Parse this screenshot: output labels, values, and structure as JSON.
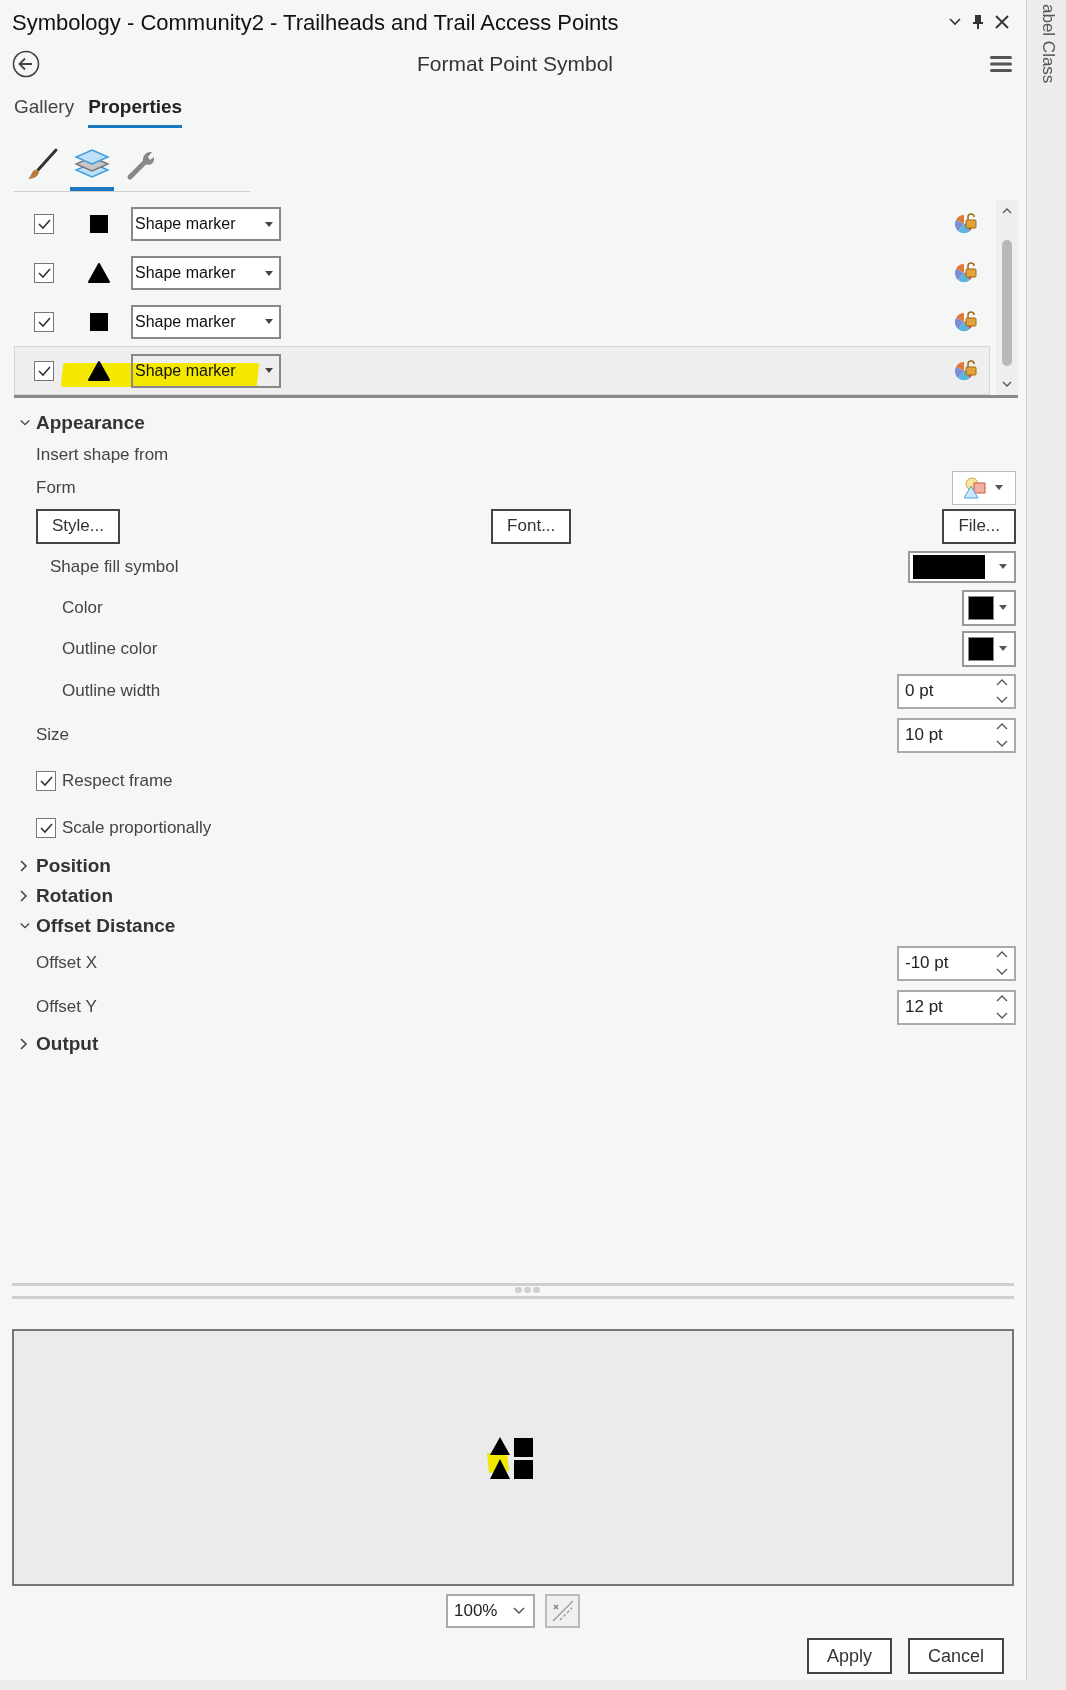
{
  "window": {
    "title": "Symbology - Community2 - Trailheads and Trail Access Points"
  },
  "side_tab": {
    "label": "abel Class"
  },
  "header": {
    "title": "Format Point Symbol"
  },
  "tabs": [
    {
      "label": "Gallery",
      "selected": false
    },
    {
      "label": "Properties",
      "selected": true
    }
  ],
  "icon_tabs": [
    {
      "kind": "brush",
      "selected": false
    },
    {
      "kind": "layers",
      "selected": true
    },
    {
      "kind": "wrench",
      "selected": false
    }
  ],
  "layers": [
    {
      "checked": true,
      "kind": "square",
      "type": "Shape marker",
      "selected": false,
      "highlighted": false
    },
    {
      "checked": true,
      "kind": "triangle",
      "type": "Shape marker",
      "selected": false,
      "highlighted": false
    },
    {
      "checked": true,
      "kind": "square",
      "type": "Shape marker",
      "selected": false,
      "highlighted": false
    },
    {
      "checked": true,
      "kind": "triangle",
      "type": "Shape marker",
      "selected": true,
      "highlighted": true
    }
  ],
  "properties": [
    {
      "kind": "group",
      "label": "Appearance",
      "expanded": true,
      "children": [
        {
          "kind": "label",
          "label": "Insert shape from"
        },
        {
          "kind": "picker",
          "label": "Form"
        },
        {
          "kind": "buttons",
          "buttons": [
            "Style...",
            "Font...",
            "File..."
          ]
        },
        {
          "kind": "swatch",
          "label": "Shape fill symbol",
          "children": [
            {
              "kind": "color",
              "label": "Color"
            },
            {
              "kind": "color",
              "label": "Outline color"
            },
            {
              "kind": "spin",
              "label": "Outline width",
              "value": "0 pt"
            }
          ]
        },
        {
          "kind": "spin",
          "label": "Size",
          "value": "10 pt"
        },
        {
          "kind": "checkbox",
          "label": "Respect frame",
          "checked": true
        },
        {
          "kind": "checkbox",
          "label": "Scale proportionally",
          "checked": true
        }
      ]
    },
    {
      "kind": "group",
      "label": "Position",
      "expanded": false
    },
    {
      "kind": "group",
      "label": "Rotation",
      "expanded": false
    },
    {
      "kind": "group",
      "label": "Offset Distance",
      "expanded": true,
      "children": [
        {
          "kind": "spin",
          "label": "Offset X",
          "value": "-10 pt"
        },
        {
          "kind": "spin",
          "label": "Offset Y",
          "value": "12 pt"
        }
      ]
    },
    {
      "kind": "group",
      "label": "Output",
      "expanded": false
    }
  ],
  "preview": {
    "zoom": "100%"
  },
  "footer_buttons": [
    "Apply",
    "Cancel"
  ]
}
